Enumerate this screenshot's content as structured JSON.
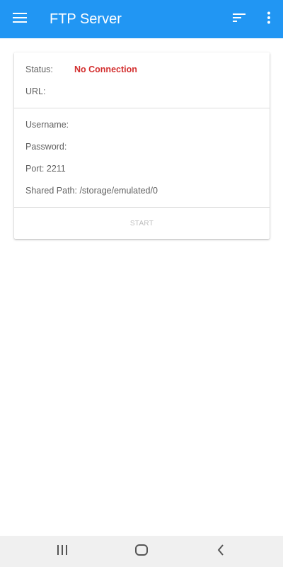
{
  "app_bar": {
    "title": "FTP Server",
    "color": "#2196F3",
    "icons": [
      "menu-icon",
      "sort-icon",
      "more-vert-icon"
    ]
  },
  "status_section": {
    "status_label": "Status:",
    "status_value": "No Connection",
    "status_color": "#D32F2F",
    "url_label": "URL:"
  },
  "details_section": {
    "username_label": "Username:",
    "password_label": "Password:",
    "port_label": "Port: 2211",
    "shared_path_label": "Shared Path: /storage/emulated/0"
  },
  "actions": {
    "start_label": "START"
  },
  "system_nav": {
    "icons": [
      "recent-apps-icon",
      "home-icon",
      "back-icon"
    ]
  }
}
